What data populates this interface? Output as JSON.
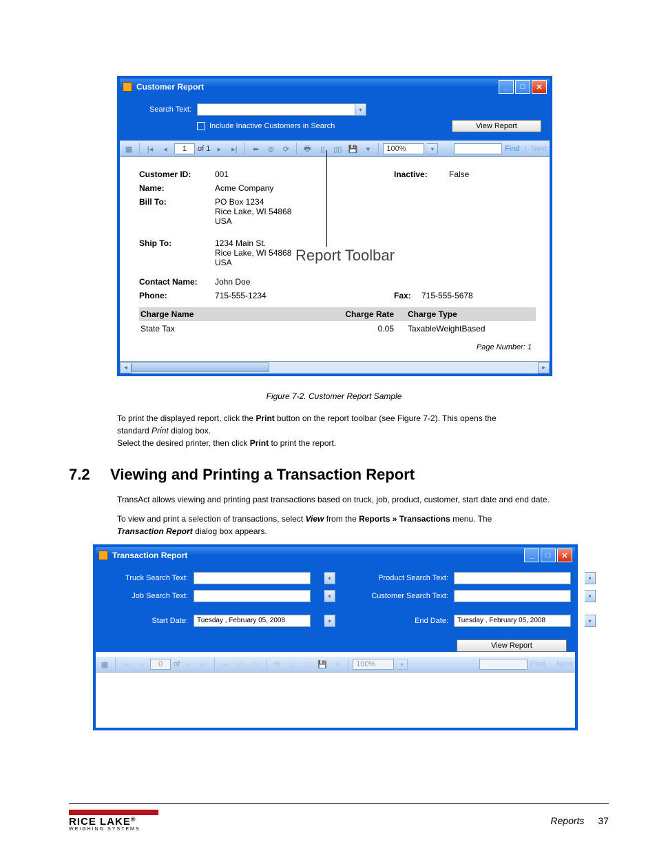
{
  "win1": {
    "title": "Customer Report",
    "search_label": "Search Text:",
    "include_inactive": "Include Inactive Customers in Search",
    "view_report_btn": "View Report",
    "toolbar": {
      "page_current": "1",
      "page_of": "of  1",
      "zoom": "100%",
      "find": "Find",
      "next": "Next"
    },
    "annotation": "Report Toolbar",
    "report": {
      "customer_id_l": "Customer ID:",
      "customer_id_v": "001",
      "inactive_l": "Inactive:",
      "inactive_v": "False",
      "name_l": "Name:",
      "name_v": "Acme Company",
      "billto_l": "Bill To:",
      "billto_v1": "PO Box 1234",
      "billto_v2": "Rice Lake, WI 54868",
      "billto_v3": "USA",
      "shipto_l": "Ship To:",
      "shipto_v1": "1234 Main St.",
      "shipto_v2": "Rice Lake, WI 54868",
      "shipto_v3": "USA",
      "contact_l": "Contact Name:",
      "contact_v": "John Doe",
      "phone_l": "Phone:",
      "phone_v": "715-555-1234",
      "fax_l": "Fax:",
      "fax_v": "715-555-5678",
      "col_charge_name": "Charge Name",
      "col_charge_rate": "Charge Rate",
      "col_charge_type": "Charge Type",
      "row_name": "State Tax",
      "row_rate": "0.05",
      "row_type": "TaxableWeightBased",
      "page_num": "Page Number: 1"
    }
  },
  "caption1": "Figure 7-2. Customer Report Sample",
  "print_para_pre": "To print the displayed report, click the ",
  "print_bold": "Print",
  "print_para_post": " button on the report toolbar (see Figure 7-2). This opens the",
  "print_line2_pre": "standard ",
  "print_dialog_i": "Print",
  "print_line2_post": " dialog box.",
  "print_line3_pre": "Select the desired printer, then click ",
  "print_line3_post": " to print the report.",
  "heading_no": "7.2",
  "heading_txt": "Viewing and Printing a Transaction Report",
  "desc1": "TransAct allows viewing and printing past transactions based on truck, job, product, customer, start date and end date.",
  "desc2_pre": "To view and print a selection of transactions, select ",
  "desc2_view": "View",
  "desc2_mid": " from the ",
  "desc2_path": "Reports » Transactions",
  "desc2_post": " menu. The ",
  "desc2_tr": "Transaction Report",
  "desc2_end": " dialog box appears.",
  "win2": {
    "title": "Transaction Report",
    "truck_l": "Truck Search Text:",
    "job_l": "Job Search Text:",
    "product_l": "Product Search Text:",
    "customer_l": "Customer Search Text:",
    "start_l": "Start Date:",
    "end_l": "End Date:",
    "date_val": "Tuesday  ,  February  05, 2008",
    "view_report_btn": "View Report",
    "toolbar": {
      "page_current": "0",
      "page_of": "of",
      "zoom": "100%",
      "find": "Find",
      "next": "Next"
    }
  },
  "footer": {
    "logo1": "RICE LAKE",
    "logo2": "WEIGHING SYSTEMS",
    "section": "Reports",
    "page": "37"
  }
}
